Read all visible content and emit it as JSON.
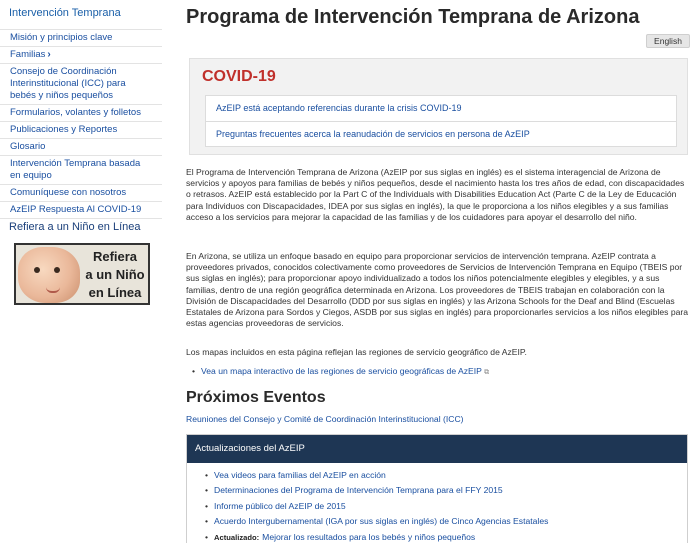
{
  "sidebar": {
    "title": "Intervención Temprana",
    "items": [
      {
        "label": "Misión y principios clave"
      },
      {
        "label": "Familias",
        "chevron": "›"
      },
      {
        "label": "Consejo de Coordinación Interinstitucional (ICC) para bebés y niños pequeños"
      },
      {
        "label": "Formularios, volantes y folletos"
      },
      {
        "label": "Publicaciones y Reportes"
      },
      {
        "label": "Glosario"
      },
      {
        "label": "Intervención Temprana basada en equipo"
      },
      {
        "label": "Comuníquese con nosotros"
      },
      {
        "label": "AzEIP Respuesta Al COVID-19"
      }
    ],
    "refer_label": "Refiera a un Niño en Línea",
    "banner": {
      "line1": "Refiera",
      "line2": "a un Niño",
      "line3": "en Línea"
    }
  },
  "header": {
    "title": "Programa de Intervención Temprana de Arizona",
    "language_button": "English"
  },
  "covid": {
    "title": "COVID-19",
    "links": [
      "AzEIP está aceptando referencias durante la crisis COVID-19",
      "Preguntas frecuentes acerca la reanudación de servicios en persona de AzEIP"
    ]
  },
  "content": {
    "paragraph1": "El Programa de Intervención Temprana de Arizona (AzEIP por sus siglas en inglés) es el sistema interagencial de Arizona de servicios y apoyos para familias de bebés y niños pequeños, desde el nacimiento hasta los tres años de edad, con discapacidades o retrasos. AzEIP está establecido por la Part C of the Individuals with Disabilities Education Act (Parte C de la Ley de Educación para Individuos con Discapacidades, IDEA por sus siglas en inglés), la que le proporciona a los niños elegibles y a sus familias acceso a los servicios para mejorar la capacidad de las familias y de los cuidadores para apoyar el desarrollo del niño.",
    "paragraph2": "En Arizona, se utiliza un enfoque basado en equipo para proporcionar servicios de intervención temprana. AzEIP contrata a proveedores privados, conocidos colectivamente como proveedores de Servicios de Intervención Temprana en Equipo (TBEIS por sus siglas en inglés); para proporcionar apoyo individualizado a todos los niños potencialmente elegibles y elegibles, y a sus familias, dentro de una región geográfica determinada en Arizona. Los proveedores de TBEIS trabajan en colaboración con la División de Discapacidades del Desarrollo (DDD por sus siglas en inglés) y las Arizona Schools for the Deaf and Blind (Escuelas Estatales de Arizona para Sordos y Ciegos, ASDB por sus siglas en inglés) para proporcionarles servicios a los niños elegibles para estas agencias proveedoras de servicios.",
    "paragraph3": "Los mapas incluidos en esta página reflejan las regiones de servicio geográfico de AzEIP.",
    "map_link": "Vea un mapa interactivo de las regiones de servicio geográficas de AzEIP"
  },
  "events": {
    "title": "Próximos Eventos",
    "link": "Reuniones del Consejo y Comité de Coordinación Interinstitucional (ICC)"
  },
  "updates": {
    "title": "Actualizaciones del AzEIP",
    "items": [
      {
        "label": "Vea videos para familias del AzEIP en acción"
      },
      {
        "label": "Determinaciones del Programa de Intervención Temprana para el FFY 2015"
      },
      {
        "label": "Informe público del AzEIP de 2015"
      },
      {
        "label": "Acuerdo Intergubernamental (IGA por sus siglas en inglés) de Cinco Agencias Estatales"
      },
      {
        "tag": "Actualizado:",
        "label": "Mejorar los resultados para los bebés y niños pequeños"
      }
    ]
  }
}
